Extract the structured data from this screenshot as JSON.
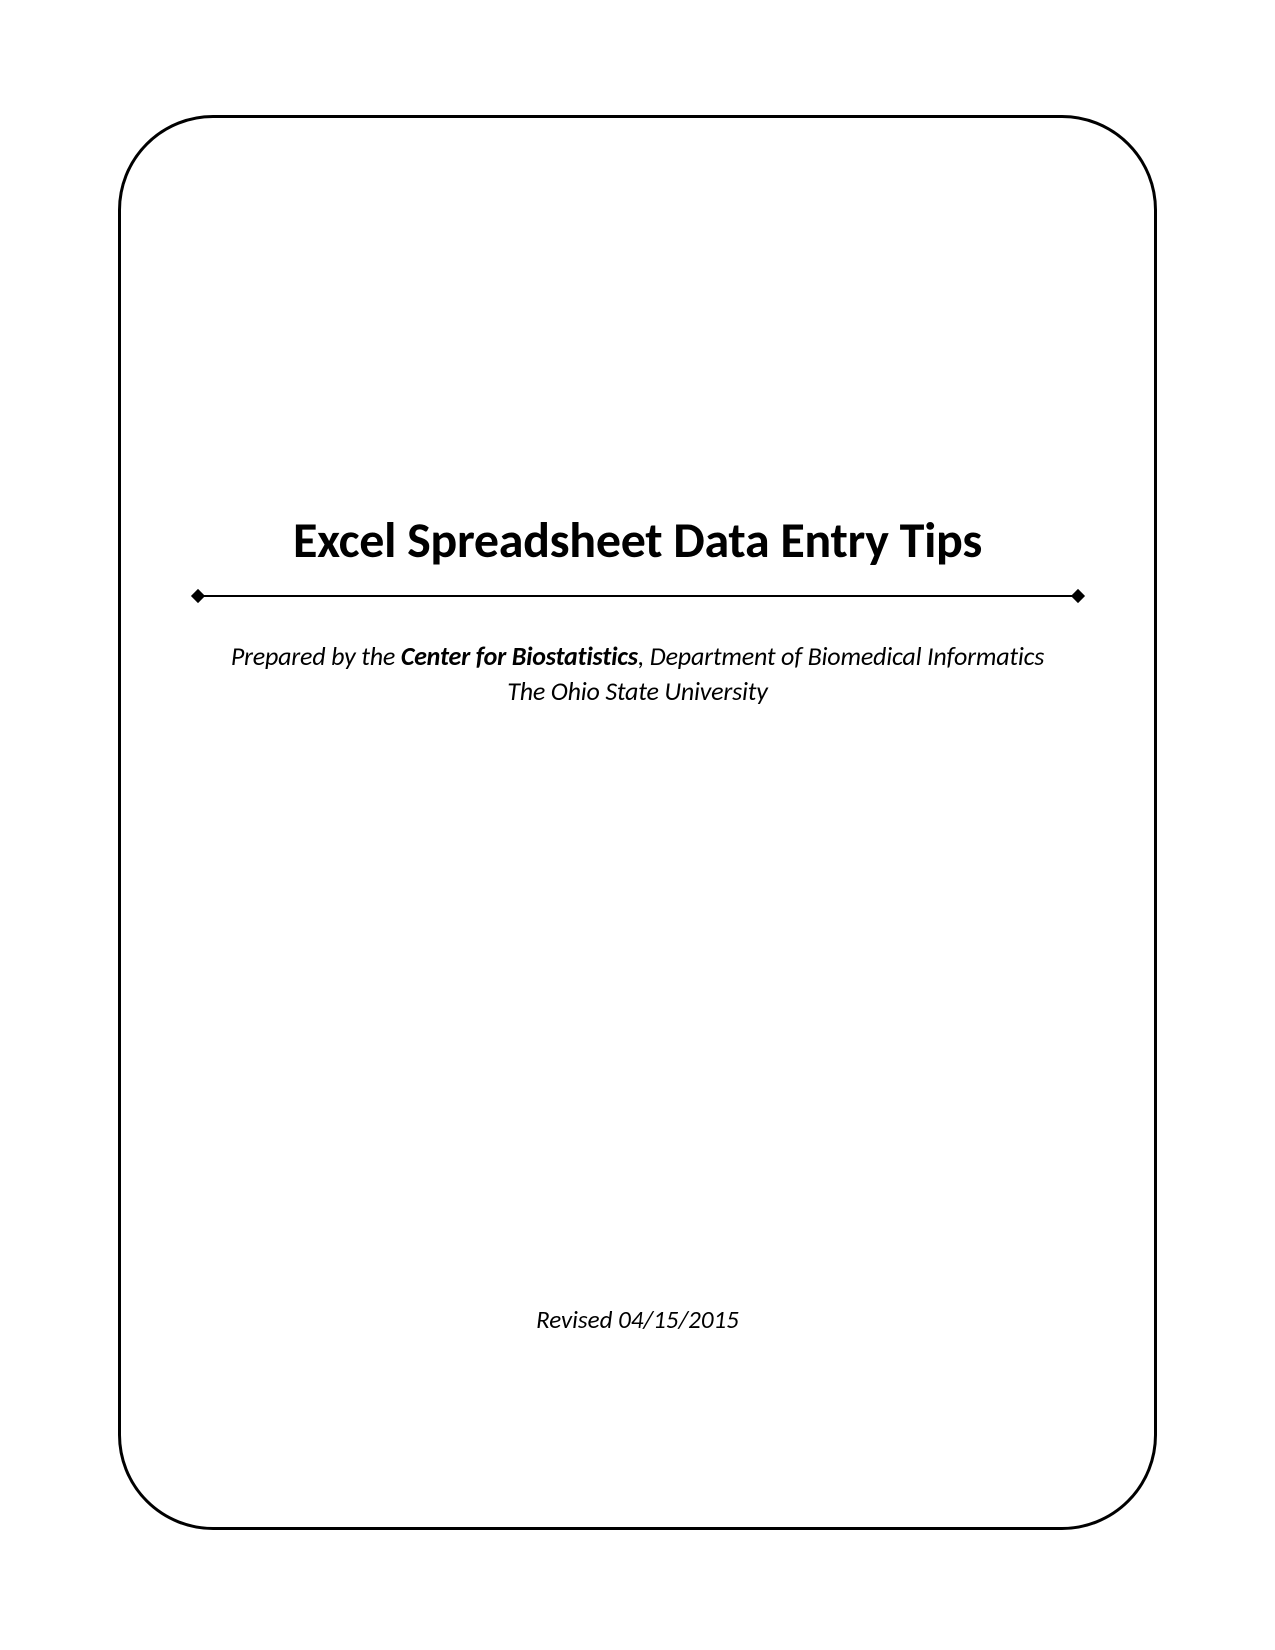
{
  "cover": {
    "title": "Excel Spreadsheet Data Entry Tips",
    "prepared_prefix": "Prepared by the ",
    "center_name": "Center for Biostatistics",
    "department_suffix": ", Department of Biomedical Informatics",
    "university": "The Ohio State University",
    "revised": "Revised 04/15/2015"
  }
}
